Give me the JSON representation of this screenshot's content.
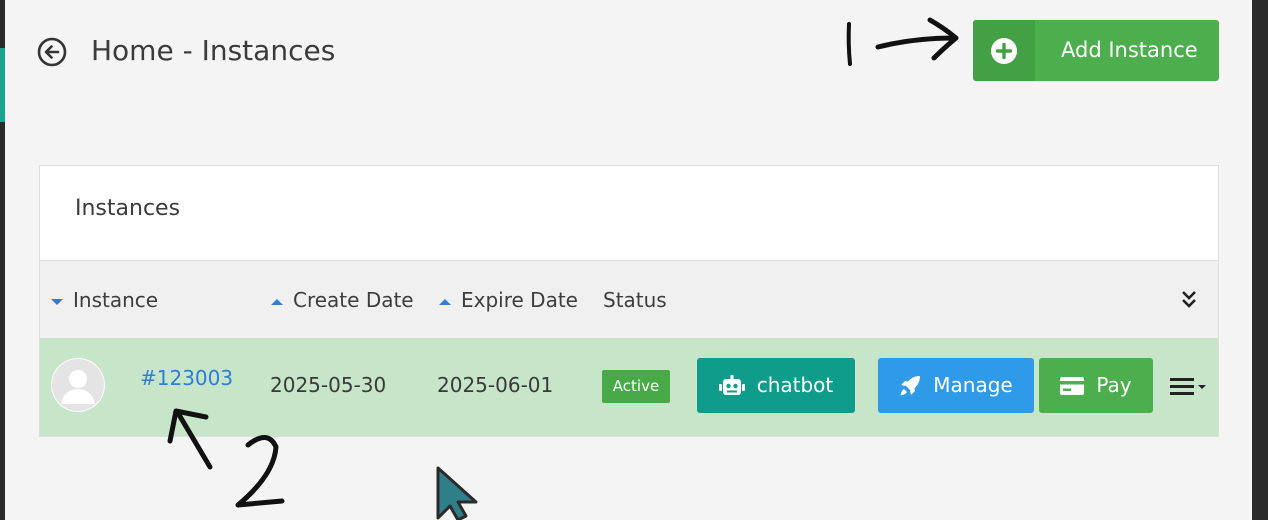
{
  "header": {
    "title": "Home - Instances",
    "back_icon": "arrow-left-circle-icon",
    "add_button_label": "Add Instance",
    "add_button_icon": "plus-circle-icon"
  },
  "panel": {
    "title": "Instances",
    "columns": [
      {
        "label": "Instance",
        "sort": "desc"
      },
      {
        "label": "Create Date",
        "sort": "asc"
      },
      {
        "label": "Expire Date",
        "sort": "asc"
      },
      {
        "label": "Status",
        "sort": "none"
      }
    ],
    "column_toggle_icon": "double-chevron-down-icon",
    "rows": [
      {
        "instance_id": "#123003",
        "create_date": "2025-05-30",
        "expire_date": "2025-06-01",
        "status": "Active",
        "actions": {
          "chatbot": "chatbot",
          "manage": "Manage",
          "pay": "Pay"
        },
        "menu_icon": "hamburger-dropdown-icon"
      }
    ]
  },
  "annotations": {
    "label_1": "1",
    "label_2": "2"
  },
  "colors": {
    "success": "#4cae4c",
    "teal": "#109c8b",
    "primary": "#2f9be8",
    "row_highlight": "#c7e5c9",
    "link": "#2e7dd6"
  }
}
